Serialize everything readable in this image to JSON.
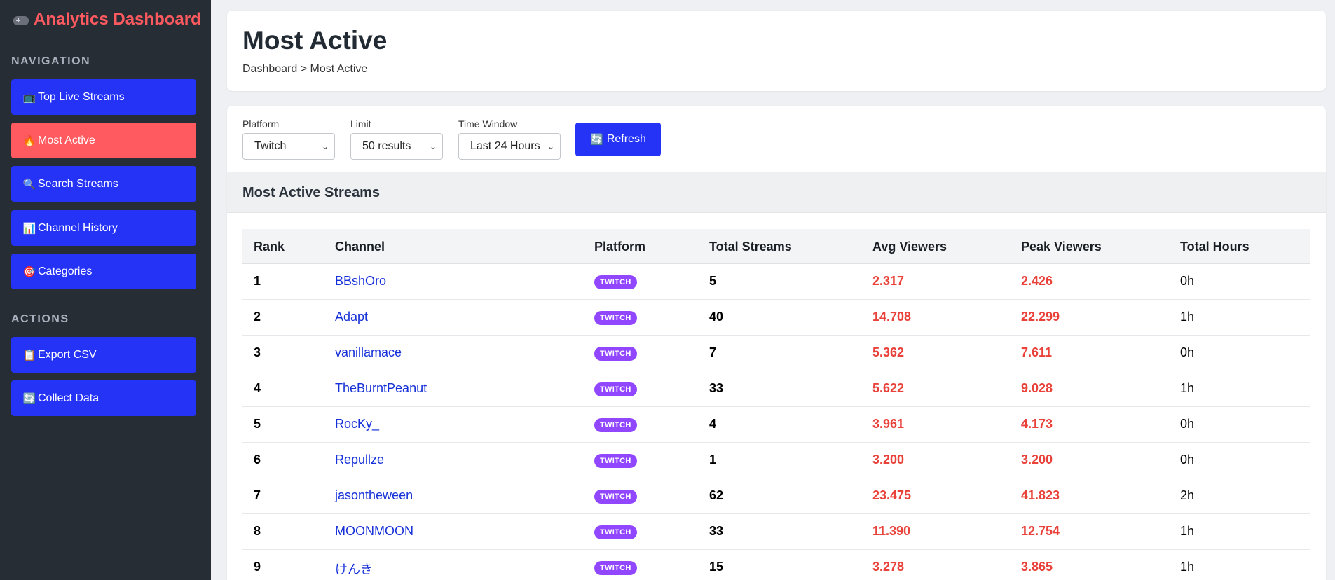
{
  "app": {
    "title": "Analytics Dashboard",
    "icon": "gamepad-icon",
    "accent_color": "#ff5a5f",
    "primary_color": "#2433f5"
  },
  "sidebar": {
    "nav_title": "NAVIGATION",
    "nav_items": [
      {
        "icon": "📺",
        "icon_name": "tv-icon",
        "label": "Top Live Streams"
      },
      {
        "icon": "🔥",
        "icon_name": "fire-icon",
        "label": "Most Active",
        "active": true
      },
      {
        "icon": "🔍",
        "icon_name": "search-icon",
        "label": "Search Streams"
      },
      {
        "icon": "📊",
        "icon_name": "bar-chart-icon",
        "label": "Channel History"
      },
      {
        "icon": "🎯",
        "icon_name": "target-icon",
        "label": "Categories"
      }
    ],
    "actions_title": "ACTIONS",
    "action_items": [
      {
        "icon": "📋",
        "icon_name": "clipboard-icon",
        "label": "Export CSV"
      },
      {
        "icon": "🔄",
        "icon_name": "refresh-icon",
        "label": "Collect Data"
      }
    ]
  },
  "header": {
    "title": "Most Active",
    "breadcrumb": "Dashboard > Most Active"
  },
  "filters": {
    "platform": {
      "label": "Platform",
      "value": "Twitch"
    },
    "limit": {
      "label": "Limit",
      "value": "50 results"
    },
    "time_window": {
      "label": "Time Window",
      "value": "Last 24 Hours"
    },
    "refresh": {
      "icon": "🔄",
      "icon_name": "refresh-icon",
      "label": "Refresh"
    }
  },
  "table": {
    "title": "Most Active Streams",
    "columns": [
      "Rank",
      "Channel",
      "Platform",
      "Total Streams",
      "Avg Viewers",
      "Peak Viewers",
      "Total Hours"
    ],
    "platform_color": "#9146ff",
    "rows": [
      {
        "rank": "1",
        "channel": "BBshOro",
        "platform": "TWITCH",
        "total_streams": "5",
        "avg_viewers": "2.317",
        "peak_viewers": "2.426",
        "total_hours": "0h"
      },
      {
        "rank": "2",
        "channel": "Adapt",
        "platform": "TWITCH",
        "total_streams": "40",
        "avg_viewers": "14.708",
        "peak_viewers": "22.299",
        "total_hours": "1h"
      },
      {
        "rank": "3",
        "channel": "vanillamace",
        "platform": "TWITCH",
        "total_streams": "7",
        "avg_viewers": "5.362",
        "peak_viewers": "7.611",
        "total_hours": "0h"
      },
      {
        "rank": "4",
        "channel": "TheBurntPeanut",
        "platform": "TWITCH",
        "total_streams": "33",
        "avg_viewers": "5.622",
        "peak_viewers": "9.028",
        "total_hours": "1h"
      },
      {
        "rank": "5",
        "channel": "RocKy_",
        "platform": "TWITCH",
        "total_streams": "4",
        "avg_viewers": "3.961",
        "peak_viewers": "4.173",
        "total_hours": "0h"
      },
      {
        "rank": "6",
        "channel": "Repullze",
        "platform": "TWITCH",
        "total_streams": "1",
        "avg_viewers": "3.200",
        "peak_viewers": "3.200",
        "total_hours": "0h"
      },
      {
        "rank": "7",
        "channel": "jasontheween",
        "platform": "TWITCH",
        "total_streams": "62",
        "avg_viewers": "23.475",
        "peak_viewers": "41.823",
        "total_hours": "2h"
      },
      {
        "rank": "8",
        "channel": "MOONMOON",
        "platform": "TWITCH",
        "total_streams": "33",
        "avg_viewers": "11.390",
        "peak_viewers": "12.754",
        "total_hours": "1h"
      },
      {
        "rank": "9",
        "channel": "けんき",
        "platform": "TWITCH",
        "total_streams": "15",
        "avg_viewers": "3.278",
        "peak_viewers": "3.865",
        "total_hours": "1h"
      }
    ]
  }
}
